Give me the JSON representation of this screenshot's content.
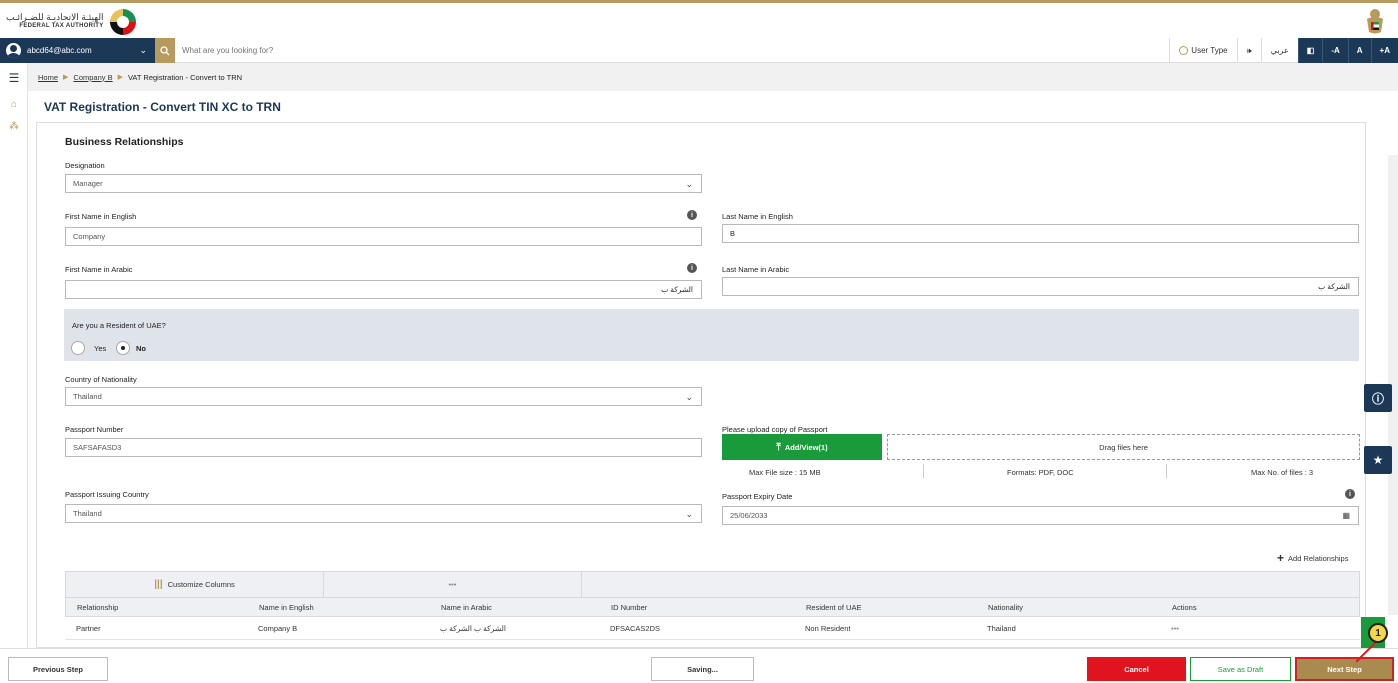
{
  "header": {
    "logo_ar": "الهيئـة الاتحاديـة للضـرائـب",
    "logo_en": "FEDERAL TAX AUTHORITY"
  },
  "searchbar": {
    "user_email": "abcd64@abc.com",
    "search_placeholder": "What are you looking for?",
    "user_type_label": "User Type",
    "audio_label": "🕪",
    "language_label": "عربي",
    "contrast_label": "◧",
    "font_smaller": "-A",
    "font_normal": "A",
    "font_larger": "+A"
  },
  "breadcrumb": {
    "home": "Home",
    "company": "Company B",
    "current": "VAT Registration - Convert to TRN"
  },
  "page": {
    "title": "VAT Registration - Convert TIN XC to TRN"
  },
  "form": {
    "section_title": "Business Relationships",
    "designation_label": "Designation",
    "designation_value": "Manager",
    "first_name_en_label": "First Name in English",
    "first_name_en_value": "Company",
    "last_name_en_label": "Last Name in English",
    "last_name_en_value": "B",
    "first_name_ar_label": "First Name in Arabic",
    "first_name_ar_value": "الشركة ب",
    "last_name_ar_label": "Last Name in Arabic",
    "last_name_ar_value": "الشركة ب",
    "resident_question": "Are you a Resident of UAE?",
    "resident_yes": "Yes",
    "resident_no": "No",
    "resident_selected": "No",
    "nationality_label": "Country of Nationality",
    "nationality_value": "Thailand",
    "passport_number_label": "Passport Number",
    "passport_number_value": "SAFSAFASD3",
    "passport_upload_label": "Please upload copy of Passport",
    "upload_button": "Add/View(1)",
    "drop_zone": "Drag files here",
    "max_file_size": "Max File size : 15 MB",
    "formats": "Formats: PDF, DOC",
    "max_files": "Max No. of files : 3",
    "issuing_country_label": "Passport Issuing Country",
    "issuing_country_value": "Thailand",
    "expiry_label": "Passport Expiry Date",
    "expiry_value": "25/06/2033",
    "add_relationships": "Add Relationships"
  },
  "table": {
    "customize_columns": "Customize Columns",
    "more": "•••",
    "headers": [
      "Relationship",
      "Name in English",
      "Name in Arabic",
      "ID Number",
      "Resident of UAE",
      "Nationality",
      "Actions"
    ],
    "rows": [
      [
        "Partner",
        "Company B",
        "الشركة ب الشركة ب",
        "DFSACAS2DS",
        "Non Resident",
        "Thailand",
        "•••"
      ]
    ]
  },
  "footer": {
    "previous": "Previous Step",
    "saving": "Saving...",
    "cancel": "Cancel",
    "save_draft": "Save as Draft",
    "next": "Next Step"
  },
  "annotation": {
    "step_number": "1"
  }
}
